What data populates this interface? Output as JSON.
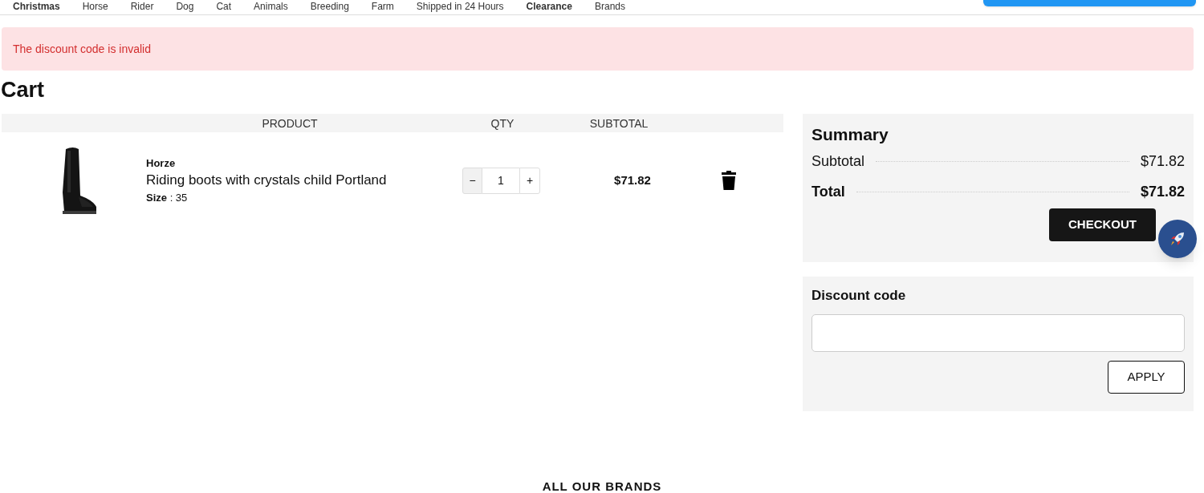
{
  "nav": {
    "items": [
      {
        "label": "Christmas",
        "bold": true
      },
      {
        "label": "Horse",
        "bold": false
      },
      {
        "label": "Rider",
        "bold": false
      },
      {
        "label": "Dog",
        "bold": false
      },
      {
        "label": "Cat",
        "bold": false
      },
      {
        "label": "Animals",
        "bold": false
      },
      {
        "label": "Breeding",
        "bold": false
      },
      {
        "label": "Farm",
        "bold": false
      },
      {
        "label": "Shipped in 24 Hours",
        "bold": false
      },
      {
        "label": "Clearance",
        "bold": true
      },
      {
        "label": "Brands",
        "bold": false
      }
    ]
  },
  "alert": {
    "message": "The discount code is invalid"
  },
  "title": "Cart",
  "table": {
    "columns": [
      "PRODUCT",
      "QTY",
      "SUBTOTAL"
    ],
    "rows": [
      {
        "brand": "Horze",
        "name": "Riding boots with crystals child Portland",
        "size": "**Size** : 35",
        "qty": "1",
        "subtotal": "$71.82",
        "minus": "−",
        "plus": "+"
      }
    ]
  },
  "summary": {
    "title": "Summary",
    "lines": [
      {
        "label": "Subtotal",
        "value": "$71.82",
        "bold": false
      },
      {
        "label": "Total",
        "value": "$71.82",
        "bold": true
      }
    ],
    "button": "CHECKOUT"
  },
  "discount": {
    "title": "Discount code",
    "button": "APPLY"
  },
  "footer": {
    "heading": "ALL OUR BRANDS"
  }
}
